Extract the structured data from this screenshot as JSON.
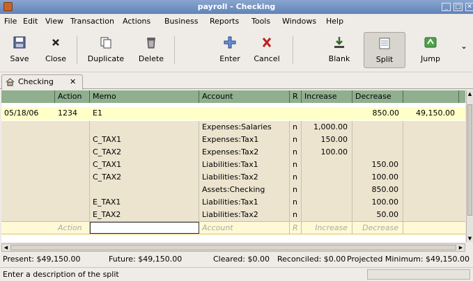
{
  "window": {
    "title": "payroll - Checking"
  },
  "menu": [
    "File",
    "Edit",
    "View",
    "Transaction",
    "Actions",
    "Business",
    "Reports",
    "Tools",
    "Windows",
    "Help"
  ],
  "toolbar": {
    "save": "Save",
    "close": "Close",
    "duplicate": "Duplicate",
    "delete": "Delete",
    "enter": "Enter",
    "cancel": "Cancel",
    "blank": "Blank",
    "split": "Split",
    "jump": "Jump",
    "more": "⌄"
  },
  "tab": {
    "label": "Checking",
    "close": "✕"
  },
  "register": {
    "headers": {
      "date": "",
      "action": "Action",
      "memo": "Memo",
      "account": "Account",
      "r": "R",
      "increase": "Increase",
      "decrease": "Decrease",
      "balance": ""
    },
    "transaction": {
      "date": "05/18/06",
      "num": "1234",
      "description": "E1",
      "increase": "",
      "decrease": "850.00",
      "balance": "49,150.00"
    },
    "splits": [
      {
        "memo": "",
        "account": "Expenses:Salaries",
        "r": "n",
        "increase": "1,000.00",
        "decrease": ""
      },
      {
        "memo": "C_TAX1",
        "account": "Expenses:Tax1",
        "r": "n",
        "increase": "150.00",
        "decrease": ""
      },
      {
        "memo": "C_TAX2",
        "account": "Expenses:Tax2",
        "r": "n",
        "increase": "100.00",
        "decrease": ""
      },
      {
        "memo": "C_TAX1",
        "account": "Liabilities:Tax1",
        "r": "n",
        "increase": "",
        "decrease": "150.00"
      },
      {
        "memo": "C_TAX2",
        "account": "Liabilities:Tax2",
        "r": "n",
        "increase": "",
        "decrease": "100.00"
      },
      {
        "memo": "",
        "account": "Assets:Checking",
        "r": "n",
        "increase": "",
        "decrease": "850.00"
      },
      {
        "memo": "E_TAX1",
        "account": "Liabilities:Tax1",
        "r": "n",
        "increase": "",
        "decrease": "100.00"
      },
      {
        "memo": "E_TAX2",
        "account": "Liabilities:Tax2",
        "r": "n",
        "increase": "",
        "decrease": "50.00"
      }
    ],
    "blank_split": {
      "action": "Action",
      "memo": "",
      "account": "Account",
      "r": "R",
      "increase": "Increase",
      "decrease": "Decrease"
    }
  },
  "summary": {
    "present": "Present: $49,150.00",
    "future": "Future: $49,150.00",
    "cleared": "Cleared: $0.00",
    "reconciled": "Reconciled: $0.00",
    "projected": "Projected Minimum: $49,150.00"
  },
  "status": "Enter a description of the split"
}
